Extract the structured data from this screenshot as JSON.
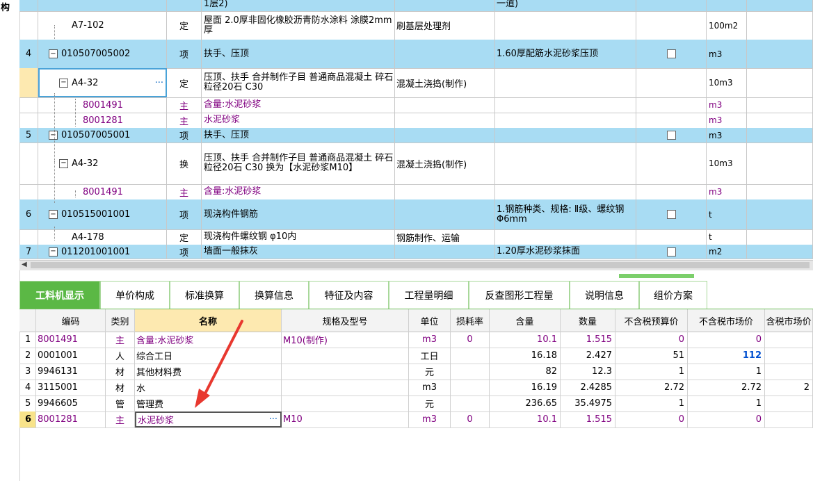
{
  "left_strip_char": "构",
  "upper_rows": [
    {
      "num": "",
      "code": "",
      "type": "",
      "name": "1层2)",
      "desc": "",
      "feat": "一道)",
      "unit": "",
      "hl": true,
      "h": 20,
      "chk": false
    },
    {
      "num": "",
      "code": "A7-102",
      "type": "定",
      "name": "屋面 2.0厚非固化橡胶沥青防水涂料 涂膜2mm厚",
      "desc": "刷基层处理剂",
      "feat": "",
      "unit": "100m2",
      "hl": false,
      "h": 41,
      "chk": false
    },
    {
      "num": "4",
      "code": "010507005002",
      "type": "项",
      "name": "扶手、压顶",
      "desc": "",
      "feat": "1.60厚配筋水泥砂浆压顶",
      "unit": "m3",
      "hl": true,
      "h": 41,
      "chk": true
    },
    {
      "num": "",
      "code": "A4-32",
      "type": "定",
      "name": "压顶、扶手 合并制作子目 普通商品混凝土 碎石粒径20石 C30",
      "desc": "混凝土浇捣(制作)",
      "feat": "",
      "unit": "10m3",
      "hl": false,
      "h": 42,
      "chk": false,
      "selected": true
    },
    {
      "num": "",
      "code": "8001491",
      "type": "主",
      "name": "含量:水泥砂浆",
      "desc": "",
      "feat": "",
      "unit": "m3",
      "hl": false,
      "h": 22,
      "chk": false,
      "purple": true
    },
    {
      "num": "",
      "code": "8001281",
      "type": "主",
      "name": "水泥砂浆",
      "desc": "",
      "feat": "",
      "unit": "m3",
      "hl": false,
      "h": 22,
      "chk": false,
      "purple": true
    },
    {
      "num": "5",
      "code": "010507005001",
      "type": "项",
      "name": "扶手、压顶",
      "desc": "",
      "feat": "",
      "unit": "m3",
      "hl": true,
      "h": 21,
      "chk": true
    },
    {
      "num": "",
      "code": "A4-32",
      "type": "换",
      "name": "压顶、扶手 合并制作子目 普通商品混凝土 碎石粒径20石 C30 换为【水泥砂浆M10】",
      "desc": "混凝土浇捣(制作)",
      "feat": "",
      "unit": "10m3",
      "hl": false,
      "h": 60,
      "chk": false
    },
    {
      "num": "",
      "code": "8001491",
      "type": "主",
      "name": "含量:水泥砂浆",
      "desc": "",
      "feat": "",
      "unit": "m3",
      "hl": false,
      "h": 22,
      "chk": false,
      "purple": true
    },
    {
      "num": "6",
      "code": "010515001001",
      "type": "项",
      "name": "现浇构件钢筋",
      "desc": "",
      "feat": "1.钢筋种类、规格: Ⅱ级、螺纹钢Φ6mm",
      "unit": "t",
      "hl": true,
      "h": 43,
      "chk": true
    },
    {
      "num": "",
      "code": "A4-178",
      "type": "定",
      "name": "现浇构件螺纹钢 φ10内",
      "desc": "钢筋制作、运输",
      "feat": "",
      "unit": "t",
      "hl": false,
      "h": 22,
      "chk": false
    },
    {
      "num": "7",
      "code": "011201001001",
      "type": "项",
      "name": "墙面一般抹灰",
      "desc": "",
      "feat": "1.20厚水泥砂浆抹面",
      "unit": "m2",
      "hl": true,
      "h": 20,
      "chk": true
    }
  ],
  "tabs": [
    "工料机显示",
    "单价构成",
    "标准换算",
    "换算信息",
    "特征及内容",
    "工程量明细",
    "反查图形工程量",
    "说明信息",
    "组价方案"
  ],
  "lower_headers": [
    "",
    "编码",
    "类别",
    "名称",
    "规格及型号",
    "单位",
    "损耗率",
    "含量",
    "数量",
    "不含税预算价",
    "不含税市场价",
    "含税市场价"
  ],
  "lower_rows": [
    {
      "n": "1",
      "code": "8001491",
      "cat": "主",
      "name": "含量:水泥砂浆",
      "spec": "M10(制作)",
      "unit": "m3",
      "loss": "0",
      "qty": "10.1",
      "amount": "1.515",
      "budget": "0",
      "market": "0",
      "tax": "",
      "purple": true
    },
    {
      "n": "2",
      "code": "0001001",
      "cat": "人",
      "name": "综合工日",
      "spec": "",
      "unit": "工日",
      "loss": "",
      "qty": "16.18",
      "amount": "2.427",
      "budget": "51",
      "market": "112",
      "tax": "",
      "blue": true
    },
    {
      "n": "3",
      "code": "9946131",
      "cat": "材",
      "name": "其他材料费",
      "spec": "",
      "unit": "元",
      "loss": "",
      "qty": "82",
      "amount": "12.3",
      "budget": "1",
      "market": "1",
      "tax": ""
    },
    {
      "n": "4",
      "code": "3115001",
      "cat": "材",
      "name": "水",
      "spec": "",
      "unit": "m3",
      "loss": "",
      "qty": "16.19",
      "amount": "2.4285",
      "budget": "2.72",
      "market": "2.72",
      "tax": "2"
    },
    {
      "n": "5",
      "code": "9946605",
      "cat": "管",
      "name": "管理费",
      "spec": "",
      "unit": "元",
      "loss": "",
      "qty": "236.65",
      "amount": "35.4975",
      "budget": "1",
      "market": "1",
      "tax": ""
    },
    {
      "n": "6",
      "code": "8001281",
      "cat": "主",
      "name": "水泥砂浆",
      "spec": "M10",
      "unit": "m3",
      "loss": "0",
      "qty": "10.1",
      "amount": "1.515",
      "budget": "0",
      "market": "0",
      "tax": "",
      "purple": true,
      "editing": true
    }
  ],
  "colors": {
    "highlight": "#a8dcf3",
    "tab_active": "#5bb845",
    "purple": "#800080",
    "arrow": "#e8382f",
    "link_blue": "#0050d0"
  },
  "icons": {
    "collapse": "minus-box-icon",
    "more": "ellipsis-icon",
    "scroll_left": "arrow-left-icon"
  }
}
